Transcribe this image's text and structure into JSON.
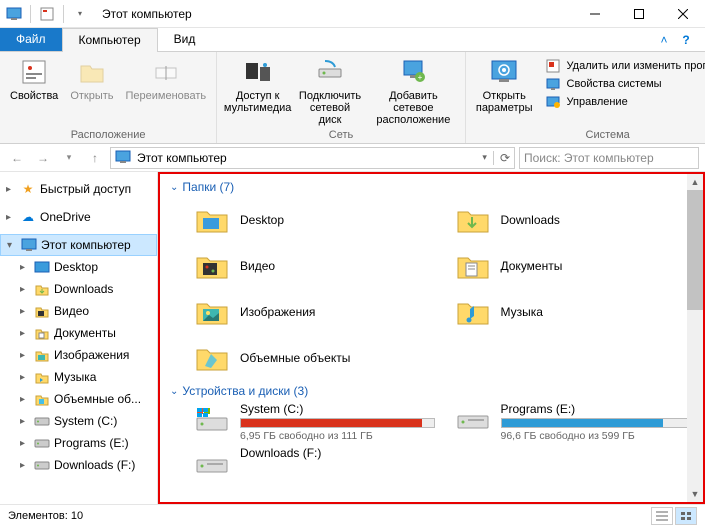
{
  "window": {
    "title": "Этот компьютер"
  },
  "tabs": {
    "file": "Файл",
    "computer": "Компьютер",
    "view": "Вид"
  },
  "ribbon": {
    "location": {
      "properties": "Свойства",
      "open": "Открыть",
      "rename": "Переименовать",
      "group_label": "Расположение"
    },
    "network": {
      "media_access": "Доступ к\nмультимедиа",
      "map_drive": "Подключить\nсетевой диск",
      "add_location": "Добавить сетевое\nрасположение",
      "group_label": "Сеть"
    },
    "system": {
      "open_settings": "Открыть\nпараметры",
      "uninstall": "Удалить или изменить программу",
      "properties": "Свойства системы",
      "manage": "Управление",
      "group_label": "Система"
    }
  },
  "address": {
    "path": "Этот компьютер",
    "search_placeholder": "Поиск: Этот компьютер"
  },
  "sidebar": {
    "quick_access": "Быстрый доступ",
    "onedrive": "OneDrive",
    "this_pc": "Этот компьютер",
    "items": [
      {
        "label": "Desktop"
      },
      {
        "label": "Downloads"
      },
      {
        "label": "Видео"
      },
      {
        "label": "Документы"
      },
      {
        "label": "Изображения"
      },
      {
        "label": "Музыка"
      },
      {
        "label": "Объемные об..."
      },
      {
        "label": "System (C:)"
      },
      {
        "label": "Programs (E:)"
      },
      {
        "label": "Downloads (F:)"
      }
    ]
  },
  "content": {
    "folders_header": "Папки (7)",
    "folders": [
      {
        "name": "Desktop",
        "accent": "#3a9bdc"
      },
      {
        "name": "Downloads",
        "accent": "#6fb84e"
      },
      {
        "name": "Видео",
        "accent": "#d84f4f"
      },
      {
        "name": "Документы",
        "accent": "#4f8ed8"
      },
      {
        "name": "Изображения",
        "accent": "#3fb7b0"
      },
      {
        "name": "Музыка",
        "accent": "#2e9bd6"
      },
      {
        "name": "Объемные объекты",
        "accent": "#46c0e8"
      }
    ],
    "drives_header": "Устройства и диски (3)",
    "drives": [
      {
        "name": "System (C:)",
        "free_text": "6,95 ГБ свободно из 111 ГБ",
        "used_pct": 94,
        "color": "#d9321c",
        "os": true
      },
      {
        "name": "Programs (E:)",
        "free_text": "96,6 ГБ свободно из 599 ГБ",
        "used_pct": 84,
        "color": "#2e9bd6",
        "os": false
      },
      {
        "name": "Downloads (F:)",
        "free_text": "",
        "used_pct": 0,
        "color": "#2e9bd6",
        "os": false
      }
    ]
  },
  "statusbar": {
    "elements": "Элементов: 10"
  }
}
